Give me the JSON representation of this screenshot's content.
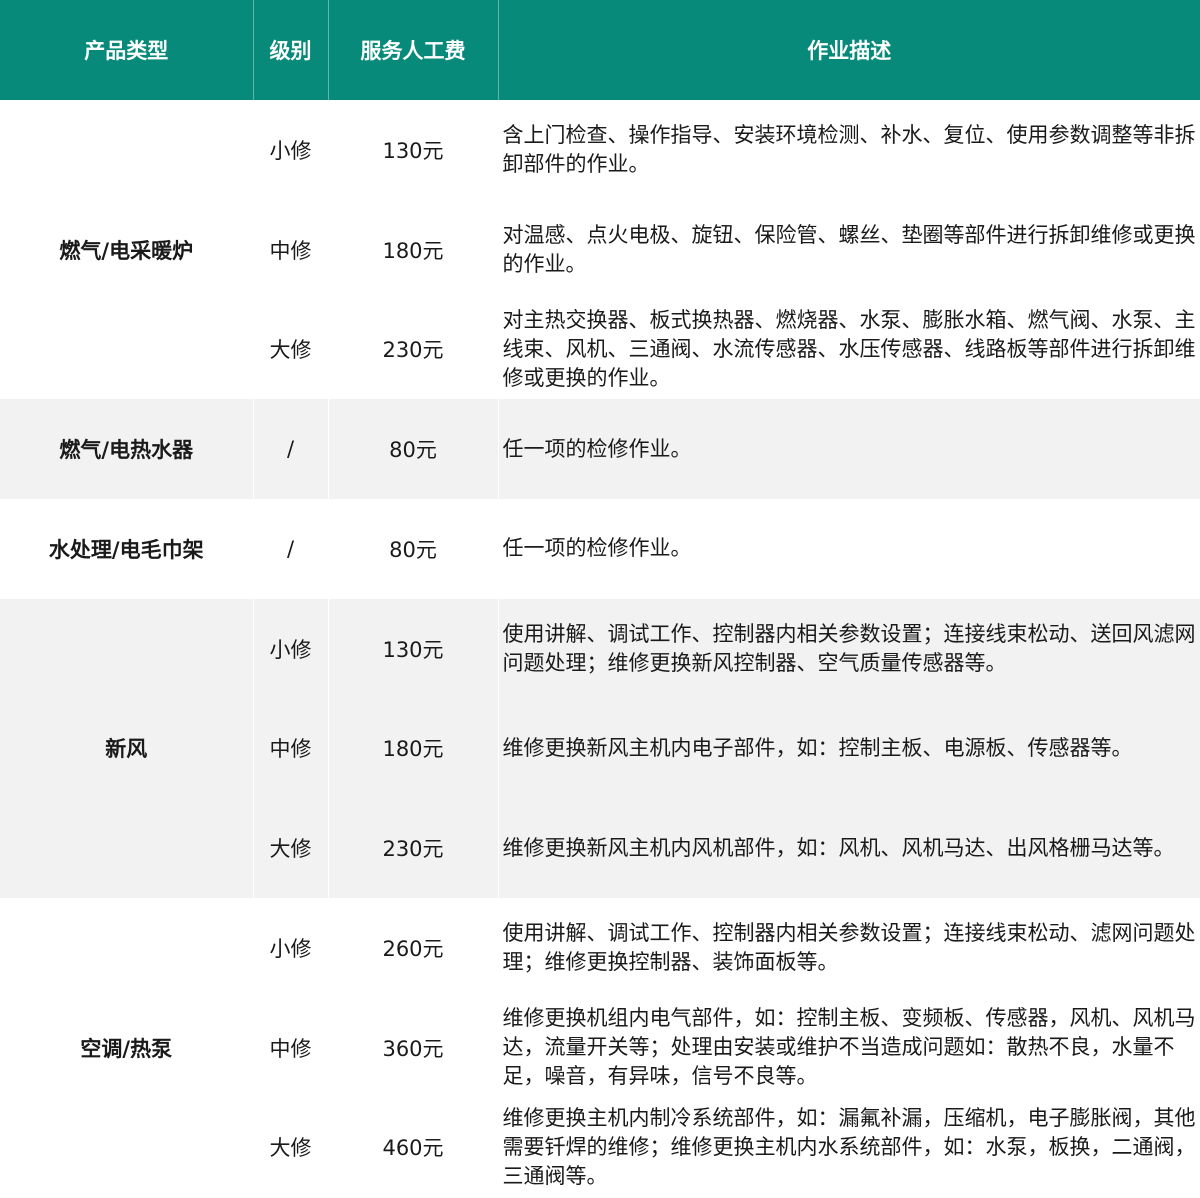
{
  "header": {
    "product_type": "产品类型",
    "level": "级别",
    "fee": "服务人工费",
    "description": "作业描述"
  },
  "groups": [
    {
      "product": "燃气/电采暖炉",
      "rows": [
        {
          "level": "小修",
          "fee": "130元",
          "desc": "含上门检查、操作指导、安装环境检测、补水、复位、使用参数调整等非拆卸部件的作业。"
        },
        {
          "level": "中修",
          "fee": "180元",
          "desc": "对温感、点火电极、旋钮、保险管、螺丝、垫圈等部件进行拆卸维修或更换的作业。"
        },
        {
          "level": "大修",
          "fee": "230元",
          "desc": "对主热交换器、板式换热器、燃烧器、水泵、膨胀水箱、燃气阀、水泵、主线束、风机、三通阀、水流传感器、水压传感器、线路板等部件进行拆卸维修或更换的作业。"
        }
      ]
    },
    {
      "product": "燃气/电热水器",
      "rows": [
        {
          "level": "/",
          "fee": "80元",
          "desc": "任一项的检修作业。"
        }
      ]
    },
    {
      "product": "水处理/电毛巾架",
      "rows": [
        {
          "level": "/",
          "fee": "80元",
          "desc": "任一项的检修作业。"
        }
      ]
    },
    {
      "product": "新风",
      "rows": [
        {
          "level": "小修",
          "fee": "130元",
          "desc": "使用讲解、调试工作、控制器内相关参数设置；连接线束松动、送回风滤网问题处理；维修更换新风控制器、空气质量传感器等。"
        },
        {
          "level": "中修",
          "fee": "180元",
          "desc": "维修更换新风主机内电子部件，如：控制主板、电源板、传感器等。"
        },
        {
          "level": "大修",
          "fee": "230元",
          "desc": "维修更换新风主机内风机部件，如：风机、风机马达、出风格栅马达等。"
        }
      ]
    },
    {
      "product": "空调/热泵",
      "rows": [
        {
          "level": "小修",
          "fee": "260元",
          "desc": "使用讲解、调试工作、控制器内相关参数设置；连接线束松动、滤网问题处理；维修更换控制器、装饰面板等。"
        },
        {
          "level": "中修",
          "fee": "360元",
          "desc": "维修更换机组内电气部件，如：控制主板、变频板、传感器，风机、风机马达，流量开关等；处理由安装或维护不当造成问题如：散热不良，水量不足，噪音，有异味，信号不良等。"
        },
        {
          "level": "大修",
          "fee": "460元",
          "desc": "维修更换主机内制冷系统部件，如：漏氟补漏，压缩机，电子膨胀阀，其他需要钎焊的维修；维修更换主机内水系统部件，如：水泵，板换，二通阀，三通阀等。"
        }
      ]
    }
  ]
}
